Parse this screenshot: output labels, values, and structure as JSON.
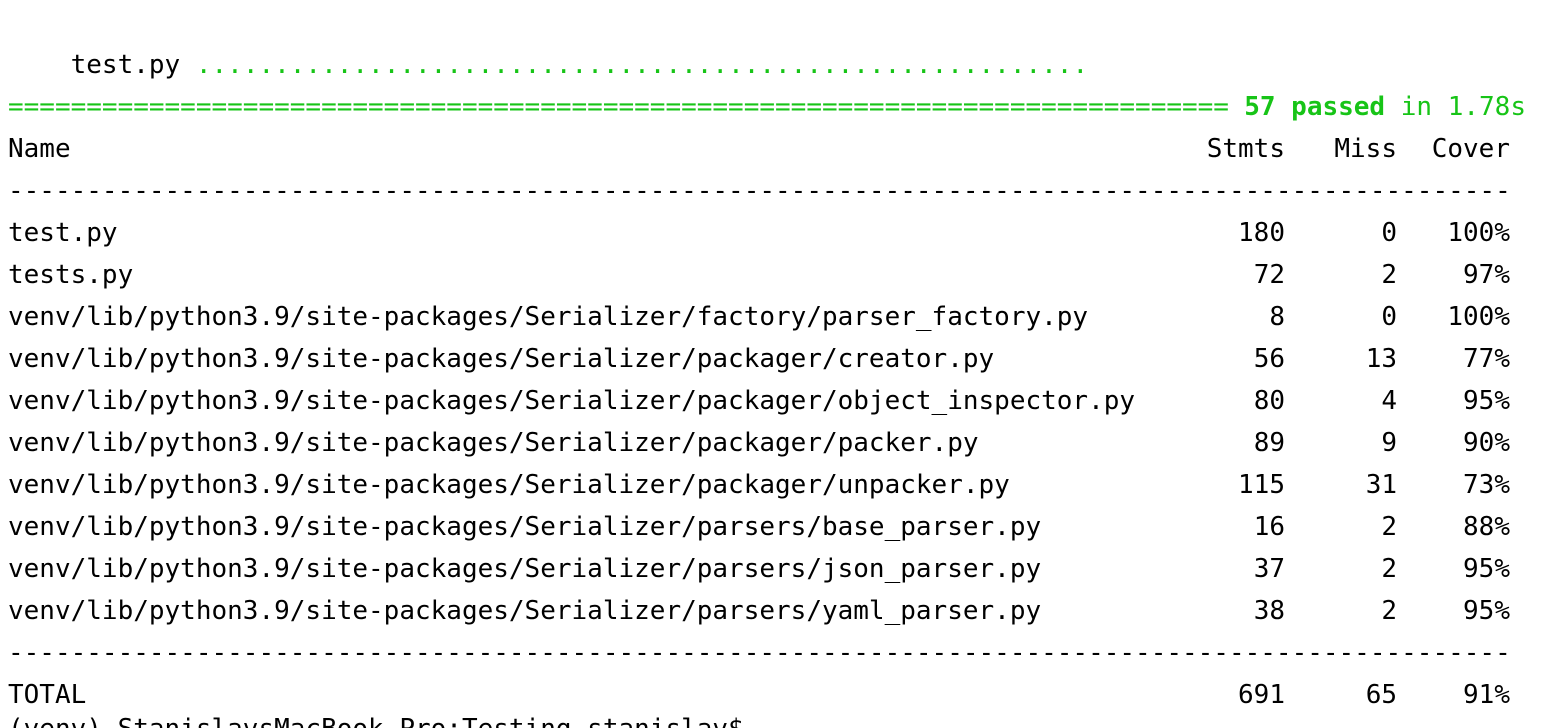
{
  "progress": {
    "file": "test.py",
    "dots": "........................................................."
  },
  "summary": {
    "separator": "==========================================================================================================================",
    "passed": "57 passed",
    "in_text": "in",
    "duration": "1.78s"
  },
  "coverage": {
    "headers": {
      "name": "Name",
      "stmts": "Stmts",
      "miss": "Miss",
      "cover": "Cover"
    },
    "rule": "--------------------------------------------------------------------------------------------------------------------------------------------------------",
    "rows": [
      {
        "name": "test.py",
        "stmts": "180",
        "miss": "0",
        "cover": "100%"
      },
      {
        "name": "tests.py",
        "stmts": "72",
        "miss": "2",
        "cover": "97%"
      },
      {
        "name": "venv/lib/python3.9/site-packages/Serializer/factory/parser_factory.py",
        "stmts": "8",
        "miss": "0",
        "cover": "100%"
      },
      {
        "name": "venv/lib/python3.9/site-packages/Serializer/packager/creator.py",
        "stmts": "56",
        "miss": "13",
        "cover": "77%"
      },
      {
        "name": "venv/lib/python3.9/site-packages/Serializer/packager/object_inspector.py",
        "stmts": "80",
        "miss": "4",
        "cover": "95%"
      },
      {
        "name": "venv/lib/python3.9/site-packages/Serializer/packager/packer.py",
        "stmts": "89",
        "miss": "9",
        "cover": "90%"
      },
      {
        "name": "venv/lib/python3.9/site-packages/Serializer/packager/unpacker.py",
        "stmts": "115",
        "miss": "31",
        "cover": "73%"
      },
      {
        "name": "venv/lib/python3.9/site-packages/Serializer/parsers/base_parser.py",
        "stmts": "16",
        "miss": "2",
        "cover": "88%"
      },
      {
        "name": "venv/lib/python3.9/site-packages/Serializer/parsers/json_parser.py",
        "stmts": "37",
        "miss": "2",
        "cover": "95%"
      },
      {
        "name": "venv/lib/python3.9/site-packages/Serializer/parsers/yaml_parser.py",
        "stmts": "38",
        "miss": "2",
        "cover": "95%"
      }
    ],
    "total": {
      "name": "TOTAL",
      "stmts": "691",
      "miss": "65",
      "cover": "91%"
    }
  },
  "prompt": {
    "text": "(venv) StanislavsMacBook-Pro:Testing stanislav$"
  },
  "colors": {
    "pass_green": "#17c417",
    "text": "#000000",
    "background": "#ffffff"
  }
}
